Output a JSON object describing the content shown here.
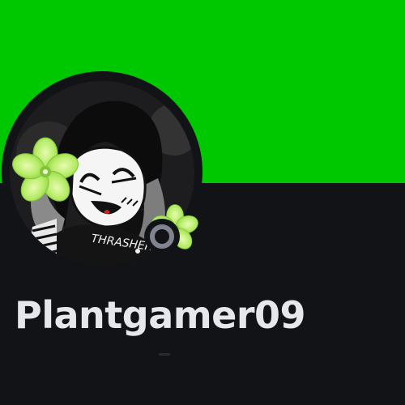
{
  "profile": {
    "banner_color": "#00C800",
    "background_color": "#121317",
    "username": "Plantgamer09",
    "status": "offline",
    "status_icon": "offline-ring-icon",
    "avatar": {
      "description_icon": "anime-avatar-icon",
      "shirt_text": "THRASHER",
      "decoration_icon": "green-flower-decoration-icon"
    }
  }
}
